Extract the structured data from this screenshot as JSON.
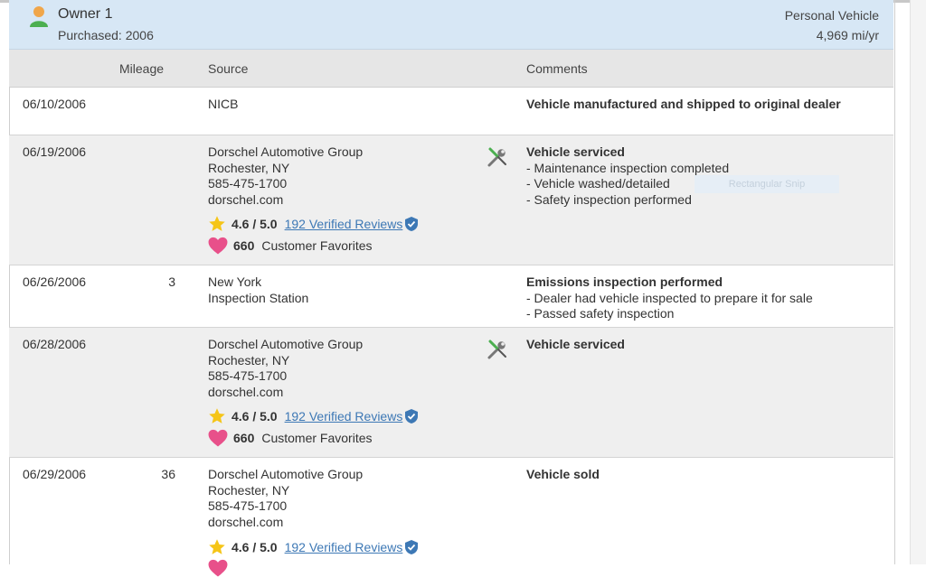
{
  "owner": {
    "title": "Owner 1",
    "purchased": "Purchased: 2006",
    "vehicle_type": "Personal Vehicle",
    "miles_per_year": "4,969 mi/yr"
  },
  "columns": {
    "mileage": "Mileage",
    "source": "Source",
    "comments": "Comments"
  },
  "rows": [
    {
      "date": "06/10/2006",
      "mileage": "",
      "source": [
        "NICB"
      ],
      "headline": "Vehicle manufactured and shipped to original dealer",
      "details": []
    },
    {
      "date": "06/19/2006",
      "mileage": "",
      "source": [
        "Dorschel Automotive Group",
        "Rochester, NY",
        "585-475-1700",
        "dorschel.com"
      ],
      "rating": "4.6 / 5.0",
      "reviews": "192 Verified Reviews",
      "favorites_count": "660",
      "favorites_label": "Customer Favorites",
      "headline": "Vehicle serviced",
      "details": [
        "- Maintenance inspection completed",
        "- Vehicle washed/detailed",
        "- Safety inspection performed"
      ]
    },
    {
      "date": "06/26/2006",
      "mileage": "3",
      "source": [
        "New York",
        "Inspection Station"
      ],
      "headline": "Emissions inspection performed",
      "details": [
        "- Dealer had vehicle inspected to prepare it for sale",
        "- Passed safety inspection"
      ]
    },
    {
      "date": "06/28/2006",
      "mileage": "",
      "source": [
        "Dorschel Automotive Group",
        "Rochester, NY",
        "585-475-1700",
        "dorschel.com"
      ],
      "rating": "4.6 / 5.0",
      "reviews": "192 Verified Reviews",
      "favorites_count": "660",
      "favorites_label": "Customer Favorites",
      "headline": "Vehicle serviced",
      "details": []
    },
    {
      "date": "06/29/2006",
      "mileage": "36",
      "source": [
        "Dorschel Automotive Group",
        "Rochester, NY",
        "585-475-1700",
        "dorschel.com"
      ],
      "rating": "4.6 / 5.0",
      "reviews": "192 Verified Reviews",
      "headline": "Vehicle sold",
      "details": []
    }
  ],
  "watermark": "Rectangular Snip",
  "colors": {
    "header_bg": "#d7e7f5",
    "alt_row_bg": "#efefef",
    "link": "#3d78b5",
    "star": "#f5c518",
    "heart": "#e8508a",
    "verified": "#3d78b5"
  },
  "icons": [
    "person-icon",
    "wrench-screwdriver-icon",
    "star-icon",
    "verified-check-icon",
    "heart-icon"
  ]
}
